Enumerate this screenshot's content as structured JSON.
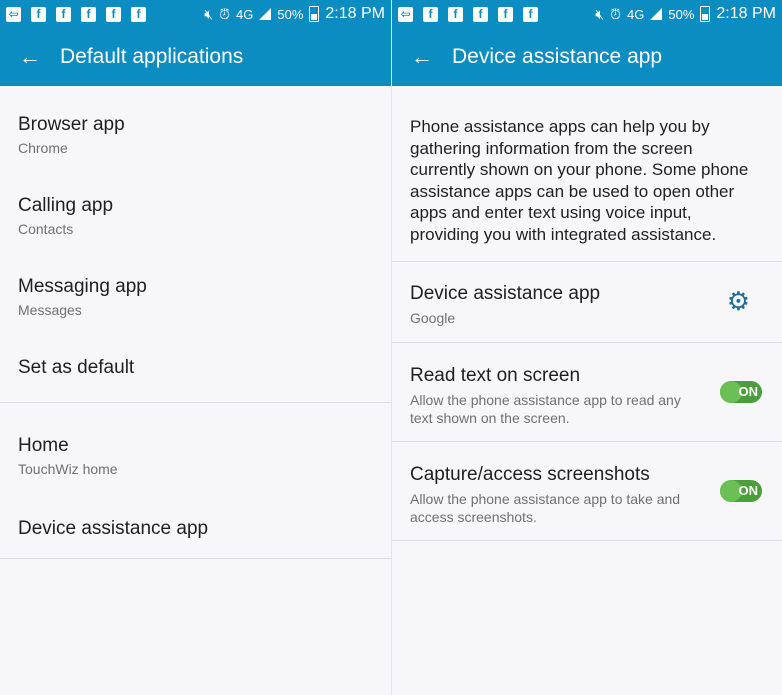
{
  "status_bar": {
    "notification_icons": [
      "message-icon",
      "f",
      "f",
      "f",
      "f",
      "f"
    ],
    "battery": "50%",
    "time": "2:18 PM",
    "network": "4G"
  },
  "left": {
    "title": "Default applications",
    "items": [
      {
        "title": "Browser app",
        "subtitle": "Chrome"
      },
      {
        "title": "Calling app",
        "subtitle": "Contacts"
      },
      {
        "title": "Messaging app",
        "subtitle": "Messages"
      },
      {
        "title": "Set as default",
        "subtitle": ""
      },
      {
        "title": "Home",
        "subtitle": "TouchWiz home"
      },
      {
        "title": "Device assistance app",
        "subtitle": ""
      }
    ]
  },
  "right": {
    "title": "Device assistance app",
    "description": "Phone assistance apps can help you by gathering information from the screen currently shown on your phone. Some phone assistance apps can be used to open other apps and enter text using voice input, providing you with integrated assistance.",
    "items": [
      {
        "title": "Device assistance app",
        "subtitle": "Google",
        "icon": "gear-icon"
      },
      {
        "title": "Read text on screen",
        "subtitle": "Allow the phone assistance app to read any text shown on the screen.",
        "toggle": "ON"
      },
      {
        "title": "Capture/access screenshots",
        "subtitle": "Allow the phone assistance app to take and access screenshots.",
        "toggle": "ON"
      }
    ]
  },
  "colors": {
    "accent": "#0b8dc1",
    "toggle_on": "#4c9e3c"
  }
}
